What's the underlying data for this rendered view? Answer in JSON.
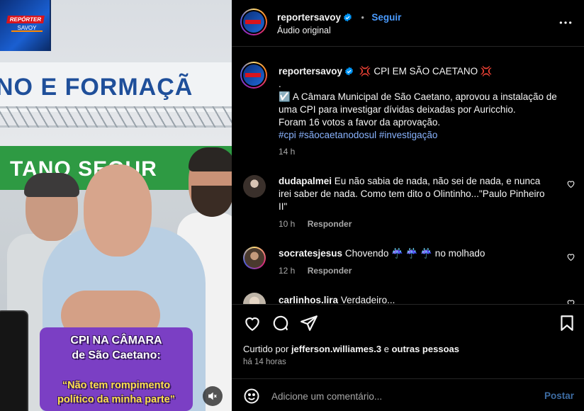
{
  "video": {
    "logo_line1": "REPÓRTER",
    "logo_line2": "SAVOY",
    "banner_top": "NO E FORMAÇÃ",
    "banner_green": "TANO SEGUR",
    "caption": {
      "line1": "CPI NA CÂMARA",
      "line2": "de São Caetano:",
      "line3": "“Não tem rompimento",
      "line4": "político da minha parte”"
    },
    "mute_icon": "speaker-muted-icon"
  },
  "header": {
    "username": "reportersavoy",
    "dot": "•",
    "follow": "Seguir",
    "subtitle": "Áudio original",
    "more_icon": "more-horizontal-icon"
  },
  "caption_post": {
    "username": "reportersavoy",
    "title": "💢 CPI EM SÃO CAETANO 💢",
    "dot": ".",
    "body1": "☑️ A Câmara Municipal de São Caetano, aprovou a instalação de uma CPI para investigar dívidas deixadas por Auricchio.",
    "body2": "Foram 16 votos a favor da aprovação.",
    "hashtags": "#cpi #sãocaetanodosul #investigação",
    "time": "14 h"
  },
  "comments": [
    {
      "username": "dudapalmei",
      "text": "Eu não sabia de nada, não sei de nada, e nunca irei saber de nada. Como tem dito o Olintinho...\"Paulo Pinheiro II\"",
      "time": "10 h",
      "reply": "Responder"
    },
    {
      "username": "socratesjesus",
      "text": "Chovendo ☔ ☔ ☔ no molhado",
      "time": "12 h",
      "reply": "Responder"
    },
    {
      "username": "carlinhos.lira",
      "text": "Verdadeiro..."
    }
  ],
  "actions": {
    "icons": [
      "heart-icon",
      "comment-icon",
      "share-icon",
      "bookmark-icon"
    ],
    "liked_prefix": "Curtido por",
    "liked_user": "jefferson.williames.3",
    "liked_and": "e",
    "liked_others": "outras pessoas",
    "time": "há 14 horas"
  },
  "composer": {
    "placeholder": "Adicione um comentário...",
    "post": "Postar"
  },
  "colors": {
    "link": "#4a9bff",
    "hashtag": "#8ab4ff",
    "caption_purple": "#7b3fc4",
    "caption_yellow": "#ffe14d"
  }
}
